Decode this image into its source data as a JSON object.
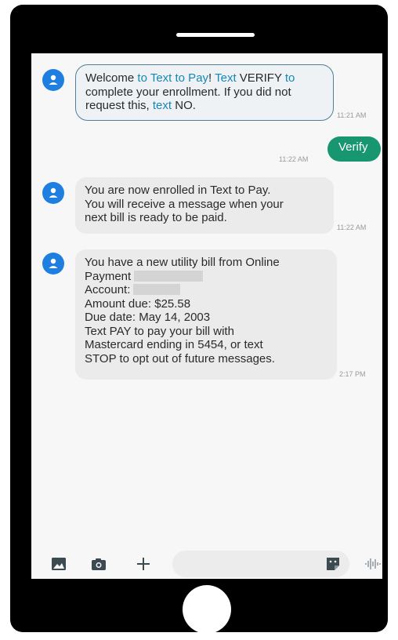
{
  "messages": [
    {
      "direction": "incoming",
      "parts": [
        {
          "text": "Welcome ",
          "highlight": false
        },
        {
          "text": "to Text to Pay",
          "highlight": true
        },
        {
          "text": "! ",
          "highlight": false
        },
        {
          "text": "Text",
          "highlight": true
        },
        {
          "text": " VERIFY ",
          "highlight": false
        },
        {
          "text": "to",
          "highlight": true
        },
        {
          "text": " complete your enrollment. If you did not request this, ",
          "highlight": false
        },
        {
          "text": "text",
          "highlight": true
        },
        {
          "text": " NO.",
          "highlight": false
        }
      ],
      "time": "11:21 AM"
    },
    {
      "direction": "outgoing",
      "text": "Verify",
      "time": "11:22 AM"
    },
    {
      "direction": "incoming",
      "text": "You are now enrolled in Text to Pay.\nYou will receive a message when your\nnext bill is ready to be paid.",
      "time": "11:22 AM"
    },
    {
      "direction": "incoming",
      "lines": [
        "You have a new utility bill from Online",
        "Payment",
        "Account:",
        "Amount due: $25.58",
        "Due date: May 14, 2003",
        "Text PAY to pay your bill with",
        "Mastercard ending in 5454, or text",
        "STOP to opt out of future messages."
      ],
      "time": "2:17 PM"
    }
  ],
  "toolbar": {
    "icons": [
      "gallery-icon",
      "camera-icon",
      "add-icon",
      "sticker-icon",
      "voice-icon"
    ]
  },
  "colors": {
    "avatar": "#1f7fe0",
    "outgoing_bubble": "#18966f",
    "highlight_text": "#1887b3"
  }
}
